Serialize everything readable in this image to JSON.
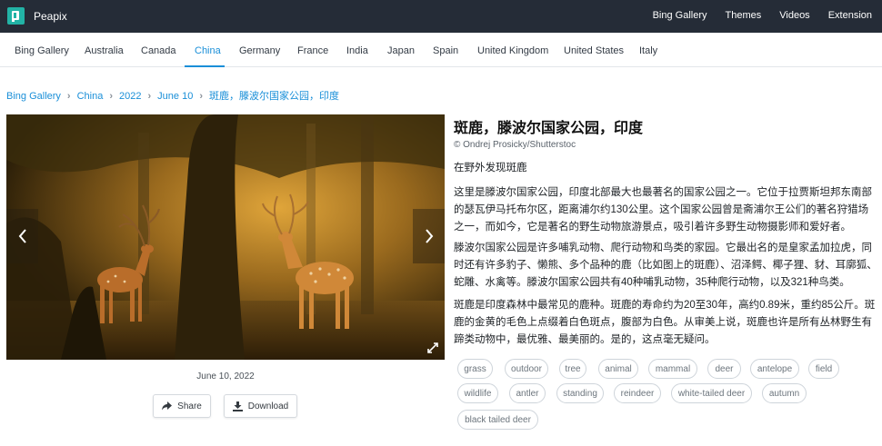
{
  "brand": {
    "name": "Peapix",
    "logo_icon": "peapix-logo-icon",
    "logo_color": "#22b3a6"
  },
  "topnav": [
    "Bing Gallery",
    "Themes",
    "Videos",
    "Extension"
  ],
  "tabs": {
    "items": [
      "Bing Gallery",
      "Australia",
      "Canada",
      "China",
      "Germany",
      "France",
      "India",
      "Japan",
      "Spain",
      "United Kingdom",
      "United States",
      "Italy"
    ],
    "active": "China",
    "accent": "#1a8fd8"
  },
  "breadcrumb": [
    "Bing Gallery",
    "China",
    "2022",
    "June 10",
    "斑鹿，滕波尔国家公园，印度"
  ],
  "photo": {
    "prev_icon": "chevron-left-icon",
    "next_icon": "chevron-right-icon",
    "expand_icon": "expand-icon"
  },
  "date": "June 10, 2022",
  "actions": {
    "share_label": "Share",
    "download_label": "Download",
    "share_icon": "share-icon",
    "download_icon": "download-icon"
  },
  "article": {
    "title": "斑鹿，滕波尔国家公园，印度",
    "credit": "© Ondrej Prosicky/Shutterstoc",
    "subtitle": "在野外发现斑鹿",
    "paragraphs": [
      "这里是滕波尔国家公园，印度北部最大也最著名的国家公园之一。它位于拉贾斯坦邦东南部的瑟瓦伊马托布尔区，距离浦尔约130公里。这个国家公园曾是斋浦尔王公们的著名狩猎场之一，而如今，它是著名的野生动物旅游景点，吸引着许多野生动物摄影师和爱好者。",
      "滕波尔国家公园是许多哺乳动物、爬行动物和鸟类的家园。它最出名的是皇家孟加拉虎，同时还有许多豹子、懒熊、多个品种的鹿（比如图上的斑鹿）、沼泽鳄、椰子狸、豺、耳廓狐、蛇雕、水禽等。滕波尔国家公园共有40种哺乳动物，35种爬行动物，以及321种鸟类。",
      "斑鹿是印度森林中最常见的鹿种。斑鹿的寿命约为20至30年，高约0.89米，重约85公斤。斑鹿的金黄的毛色上点缀着白色斑点，腹部为白色。从审美上说，斑鹿也许是所有丛林野生有蹄类动物中，最优雅、最美丽的。是的，这点毫无疑问。"
    ]
  },
  "tags": [
    "grass",
    "outdoor",
    "tree",
    "animal",
    "mammal",
    "deer",
    "antelope",
    "field",
    "wildlife",
    "antler",
    "standing",
    "reindeer",
    "white-tailed deer",
    "autumn",
    "black tailed deer"
  ]
}
